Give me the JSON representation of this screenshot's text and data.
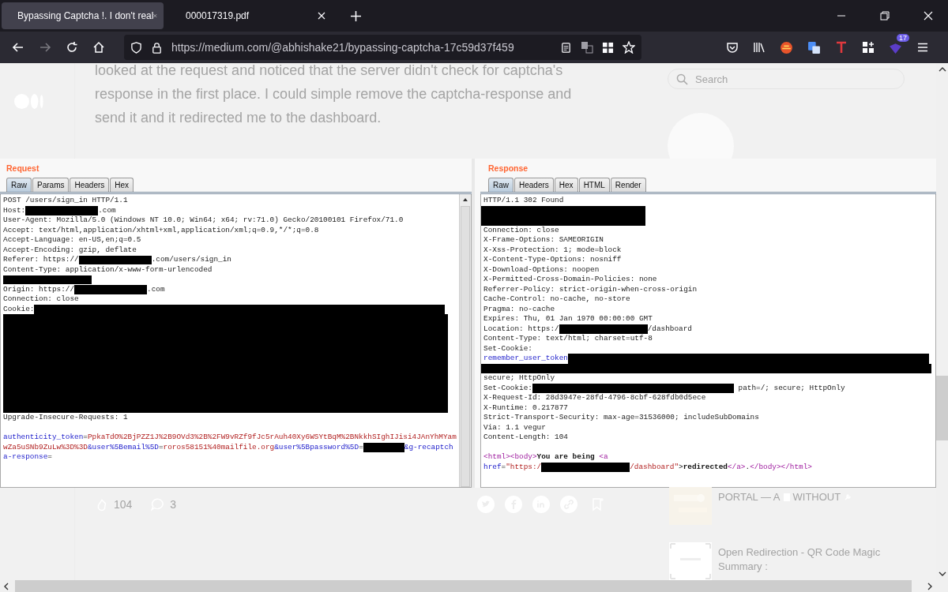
{
  "browser": {
    "tabs": [
      {
        "title": "Bypassing Captcha !. I don't real",
        "selected": true
      },
      {
        "title": "000017319.pdf",
        "selected": false
      }
    ],
    "forward_disabled": true,
    "url": "https://medium.com/@abhishake21/bypassing-captcha-17c59d37f459",
    "extension_badge": "17"
  },
  "article": {
    "paragraph": "looked at the request and noticed that the server didn't check for captcha's response in the first place. I could simple remove the captcha-response and send it and it redirected me to the dashboard.",
    "search_placeholder": "Search",
    "claps": "104",
    "responses": "3",
    "related": [
      {
        "title_start": "PORTAL — A",
        "title_end": "WITHOUT"
      },
      {
        "title": "Open Redirection - QR Code Magic Summary :"
      }
    ]
  },
  "burp": {
    "request": {
      "title": "Request",
      "tabs": [
        {
          "label": "Raw",
          "selected": true
        },
        {
          "label": "Params",
          "selected": false
        },
        {
          "label": "Headers",
          "selected": false
        },
        {
          "label": "Hex",
          "selected": false
        }
      ],
      "lines": [
        {
          "kind": "line",
          "segs": [
            {
              "kind": "plain",
              "text": "POST /users/sign_in HTTP/1.1"
            }
          ]
        },
        {
          "kind": "line",
          "segs": [
            {
              "kind": "plain",
              "text": "Host:"
            },
            {
              "kind": "midbar"
            },
            {
              "kind": "plain",
              "text": ".com"
            }
          ]
        },
        {
          "kind": "line",
          "segs": [
            {
              "kind": "plain",
              "text": "User-Agent: Mozilla/5.0 (Windows NT 10.0; Win64; x64; rv:71.0) Gecko/20100101 Firefox/71.0"
            }
          ]
        },
        {
          "kind": "line",
          "segs": [
            {
              "kind": "plain",
              "text": "Accept: text/html,application/xhtml+xml,application/xml;q=0.9,*/*;q=0.8"
            }
          ]
        },
        {
          "kind": "line",
          "segs": [
            {
              "kind": "plain",
              "text": "Accept-Language: en-US,en;q=0.5"
            }
          ]
        },
        {
          "kind": "line",
          "segs": [
            {
              "kind": "plain",
              "text": "Accept-Encoding: gzip, deflate"
            }
          ]
        },
        {
          "kind": "line",
          "segs": [
            {
              "kind": "plain",
              "text": "Referer: https://"
            },
            {
              "kind": "midbar"
            },
            {
              "kind": "plain",
              "text": ".com/users/sign_in"
            }
          ]
        },
        {
          "kind": "line",
          "segs": [
            {
              "kind": "plain",
              "text": "Content-Type: application/x-www-form-urlencoded"
            }
          ]
        },
        {
          "kind": "line",
          "segs": [
            {
              "kind": "longbar"
            }
          ]
        },
        {
          "kind": "line",
          "segs": [
            {
              "kind": "plain",
              "text": "Origin: https://"
            },
            {
              "kind": "midbar"
            },
            {
              "kind": "plain",
              "text": ".com"
            }
          ]
        },
        {
          "kind": "line",
          "segs": [
            {
              "kind": "plain",
              "text": "Connection: close"
            }
          ]
        },
        {
          "kind": "line",
          "segs": [
            {
              "kind": "plain",
              "text": "Cookie:"
            },
            {
              "kind": "widebar"
            }
          ]
        },
        {
          "kind": "tallblock"
        },
        {
          "kind": "line",
          "segs": [
            {
              "kind": "plain",
              "text": "Upgrade-Insecure-Requests: 1"
            }
          ]
        },
        {
          "kind": "blank"
        },
        {
          "kind": "line",
          "segs": [
            {
              "kind": "key",
              "text": "authenticity_token"
            },
            {
              "kind": "plain",
              "text": "="
            },
            {
              "kind": "value",
              "text": "PpkaTdO%2BjPZZ1J%2B9OVd3%2B%2FW9vRZf9fJc5rAuh40Xy6WSYtBqM%2BNkkhSIghIJisi4JAnYhMYam"
            }
          ]
        },
        {
          "kind": "line",
          "segs": [
            {
              "kind": "value",
              "text": "wZa5uSNb9ZuLw%3D%3D"
            },
            {
              "kind": "key",
              "text": "&user%5Bemail%5D"
            },
            {
              "kind": "plain",
              "text": "="
            },
            {
              "kind": "value",
              "text": "roros58151%40mailfile.org"
            },
            {
              "kind": "key",
              "text": "&user%5Bpassword%5D"
            },
            {
              "kind": "plain",
              "text": "="
            },
            {
              "kind": "shortbar"
            },
            {
              "kind": "key",
              "text": "&g-recaptch"
            }
          ]
        },
        {
          "kind": "line",
          "segs": [
            {
              "kind": "key",
              "text": "a-response"
            },
            {
              "kind": "plain",
              "text": "="
            }
          ]
        }
      ]
    },
    "response": {
      "title": "Response",
      "tabs": [
        {
          "label": "Raw",
          "selected": true
        },
        {
          "label": "Headers",
          "selected": false
        },
        {
          "label": "Hex",
          "selected": false
        },
        {
          "label": "HTML",
          "selected": false
        },
        {
          "label": "Render",
          "selected": false
        }
      ],
      "lines": [
        {
          "kind": "line",
          "segs": [
            {
              "kind": "plain",
              "text": "HTTP/1.1 302 Found"
            }
          ]
        },
        {
          "kind": "shortblock"
        },
        {
          "kind": "line",
          "segs": [
            {
              "kind": "plain",
              "text": "Connection: close"
            }
          ]
        },
        {
          "kind": "line",
          "segs": [
            {
              "kind": "plain",
              "text": "X-Frame-Options: SAMEORIGIN"
            }
          ]
        },
        {
          "kind": "line",
          "segs": [
            {
              "kind": "plain",
              "text": "X-Xss-Protection: 1; mode=block"
            }
          ]
        },
        {
          "kind": "line",
          "segs": [
            {
              "kind": "plain",
              "text": "X-Content-Type-Options: nosniff"
            }
          ]
        },
        {
          "kind": "line",
          "segs": [
            {
              "kind": "plain",
              "text": "X-Download-Options: noopen"
            }
          ]
        },
        {
          "kind": "line",
          "segs": [
            {
              "kind": "plain",
              "text": "X-Permitted-Cross-Domain-Policies: none"
            }
          ]
        },
        {
          "kind": "line",
          "segs": [
            {
              "kind": "plain",
              "text": "Referrer-Policy: strict-origin-when-cross-origin"
            }
          ]
        },
        {
          "kind": "line",
          "segs": [
            {
              "kind": "plain",
              "text": "Cache-Control: no-cache, no-store"
            }
          ]
        },
        {
          "kind": "line",
          "segs": [
            {
              "kind": "plain",
              "text": "Pragma: no-cache"
            }
          ]
        },
        {
          "kind": "line",
          "segs": [
            {
              "kind": "plain",
              "text": "Expires: Thu, 01 Jan 1970 00:00:00 GMT"
            }
          ]
        },
        {
          "kind": "line",
          "segs": [
            {
              "kind": "plain",
              "text": "Location: https:/"
            },
            {
              "kind": "longbar"
            },
            {
              "kind": "plain",
              "text": "/dashboard"
            }
          ]
        },
        {
          "kind": "line",
          "segs": [
            {
              "kind": "plain",
              "text": "Content-Type: text/html; charset=utf-8"
            }
          ]
        },
        {
          "kind": "line",
          "segs": [
            {
              "kind": "plain",
              "text": "Set-Cookie:"
            }
          ]
        },
        {
          "kind": "line",
          "segs": [
            {
              "kind": "key",
              "text": "remember_user_token"
            },
            {
              "kind": "fullbar"
            }
          ]
        },
        {
          "kind": "barblock"
        },
        {
          "kind": "line",
          "segs": [
            {
              "kind": "plain",
              "text": "secure; HttpOnly"
            }
          ]
        },
        {
          "kind": "line",
          "segs": [
            {
              "kind": "plain",
              "text": "Set-Cookie:"
            },
            {
              "kind": "xlbar"
            },
            {
              "kind": "plain",
              "text": " path=/; secure; HttpOnly"
            }
          ]
        },
        {
          "kind": "line",
          "segs": [
            {
              "kind": "plain",
              "text": "X-Request-Id: 28d3947e-28fd-4796-8cbf-628fdb0d5ece"
            }
          ]
        },
        {
          "kind": "line",
          "segs": [
            {
              "kind": "plain",
              "text": "X-Runtime: 0.217877"
            }
          ]
        },
        {
          "kind": "line",
          "segs": [
            {
              "kind": "plain",
              "text": "Strict-Transport-Security: max-age=31536000; includeSubDomains"
            }
          ]
        },
        {
          "kind": "line",
          "segs": [
            {
              "kind": "plain",
              "text": "Via: 1.1 vegur"
            }
          ]
        },
        {
          "kind": "line",
          "segs": [
            {
              "kind": "plain",
              "text": "Content-Length: 104"
            }
          ]
        },
        {
          "kind": "blank"
        },
        {
          "kind": "line",
          "segs": [
            {
              "kind": "tag",
              "text": "<html><body>"
            },
            {
              "kind": "bold",
              "text": "You are being "
            },
            {
              "kind": "tag",
              "text": "<a"
            }
          ]
        },
        {
          "kind": "line",
          "segs": [
            {
              "kind": "key",
              "text": "href"
            },
            {
              "kind": "plain",
              "text": "="
            },
            {
              "kind": "value",
              "text": "\"https:/"
            },
            {
              "kind": "longbar"
            },
            {
              "kind": "value",
              "text": "/dashboard\""
            },
            {
              "kind": "plain",
              "text": ">"
            },
            {
              "kind": "bold",
              "text": "redirected"
            },
            {
              "kind": "tag",
              "text": "</a>"
            },
            {
              "kind": "plain",
              "text": "."
            },
            {
              "kind": "tag",
              "text": "</body></html>"
            }
          ]
        }
      ]
    }
  }
}
